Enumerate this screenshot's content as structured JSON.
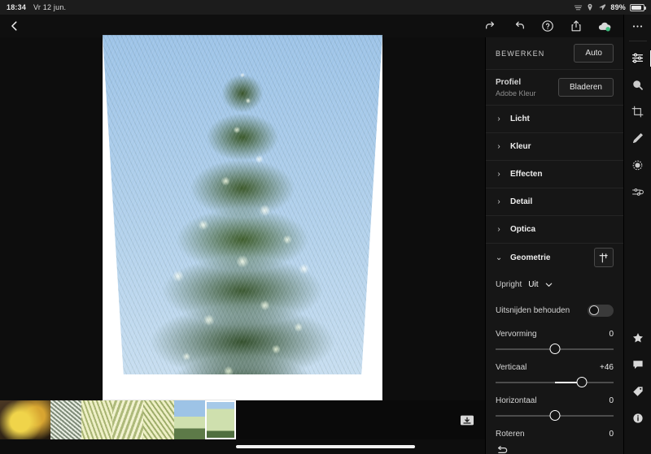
{
  "status_bar": {
    "time": "18:34",
    "date": "Vr 12 jun.",
    "battery_percent": "89%",
    "icons": [
      "screen-mirroring-icon",
      "location-icon",
      "wifi-icon"
    ]
  },
  "toolbar": {
    "back_icon": "chevron-left-icon",
    "actions": [
      {
        "name": "redo-button",
        "icon": "redo-icon"
      },
      {
        "name": "undo-button",
        "icon": "undo-icon"
      },
      {
        "name": "help-button",
        "icon": "question-circle-icon"
      },
      {
        "name": "share-button",
        "icon": "share-icon"
      },
      {
        "name": "cloud-sync-button",
        "icon": "cloud-icon"
      },
      {
        "name": "more-options-button",
        "icon": "ellipsis-icon"
      }
    ]
  },
  "panel": {
    "header_label": "BEWERKEN",
    "auto_label": "Auto",
    "profile": {
      "label": "Profiel",
      "value": "Adobe Kleur",
      "browse_label": "Bladeren"
    },
    "sections": [
      {
        "label": "Licht",
        "expanded": false
      },
      {
        "label": "Kleur",
        "expanded": false
      },
      {
        "label": "Effecten",
        "expanded": false
      },
      {
        "label": "Detail",
        "expanded": false
      },
      {
        "label": "Optica",
        "expanded": false
      },
      {
        "label": "Geometrie",
        "expanded": true
      }
    ],
    "geometry": {
      "upright_label": "Upright",
      "upright_value": "Uit",
      "keep_crop_label": "Uitsnijden behouden",
      "keep_crop_on": false,
      "sliders": [
        {
          "label": "Vervorming",
          "value": "0",
          "percent": 50
        },
        {
          "label": "Verticaal",
          "value": "+46",
          "percent": 73
        },
        {
          "label": "Horizontaal",
          "value": "0",
          "percent": 50
        },
        {
          "label": "Roteren",
          "value": "0",
          "percent": 50
        }
      ],
      "reset_icon": "reset-icon"
    }
  },
  "rail": {
    "items": [
      {
        "name": "edit-tool",
        "icon": "sliders-icon",
        "active": true
      },
      {
        "name": "healing-tool",
        "icon": "healing-brush-icon",
        "active": false
      },
      {
        "name": "crop-tool",
        "icon": "crop-icon",
        "active": false
      },
      {
        "name": "brush-tool",
        "icon": "brush-icon",
        "active": false
      },
      {
        "name": "masking-tool",
        "icon": "masking-circle-icon",
        "active": false
      },
      {
        "name": "presets-tool",
        "icon": "presets-icon",
        "active": false
      }
    ],
    "bottom_items": [
      {
        "name": "rating-button",
        "icon": "star-icon"
      },
      {
        "name": "comments-button",
        "icon": "comment-icon"
      },
      {
        "name": "keywords-button",
        "icon": "tag-icon"
      },
      {
        "name": "info-button",
        "icon": "info-icon"
      }
    ]
  },
  "filmstrip": {
    "selected_index": 6,
    "thumbnails": [
      {
        "name": "thumbnail-yellow-flowers",
        "colors": [
          "#3a2a1c",
          "#e8c93c",
          "#b98a2a"
        ]
      },
      {
        "name": "thumbnail-white-blossom",
        "colors": [
          "#8d9a8a",
          "#e9efe4",
          "#6e7c6a"
        ]
      },
      {
        "name": "thumbnail-blossom-branch-1",
        "colors": [
          "#cfd79a",
          "#eef0c8",
          "#9aa86a"
        ]
      },
      {
        "name": "thumbnail-blossom-branch-2",
        "colors": [
          "#d6dda4",
          "#f0f1cf",
          "#a3b070"
        ]
      },
      {
        "name": "thumbnail-blossom-branch-3",
        "colors": [
          "#cdd79c",
          "#edefc6",
          "#99a768"
        ]
      },
      {
        "name": "thumbnail-tree-sky",
        "colors": [
          "#9dc3e6",
          "#5d7a48",
          "#d9e3b2"
        ]
      },
      {
        "name": "thumbnail-conifer-tree",
        "colors": [
          "#a6c9e8",
          "#4f6e3f",
          "#cfe0ae"
        ]
      }
    ],
    "action_icon": "export-to-device-icon"
  },
  "photo": {
    "name": "conifer-tree-photo",
    "sky_color": "#a8c8e8",
    "foliage_light": "#dde9bb",
    "foliage_dark": "#3b5a2d",
    "canvas_background": "#ffffff"
  }
}
